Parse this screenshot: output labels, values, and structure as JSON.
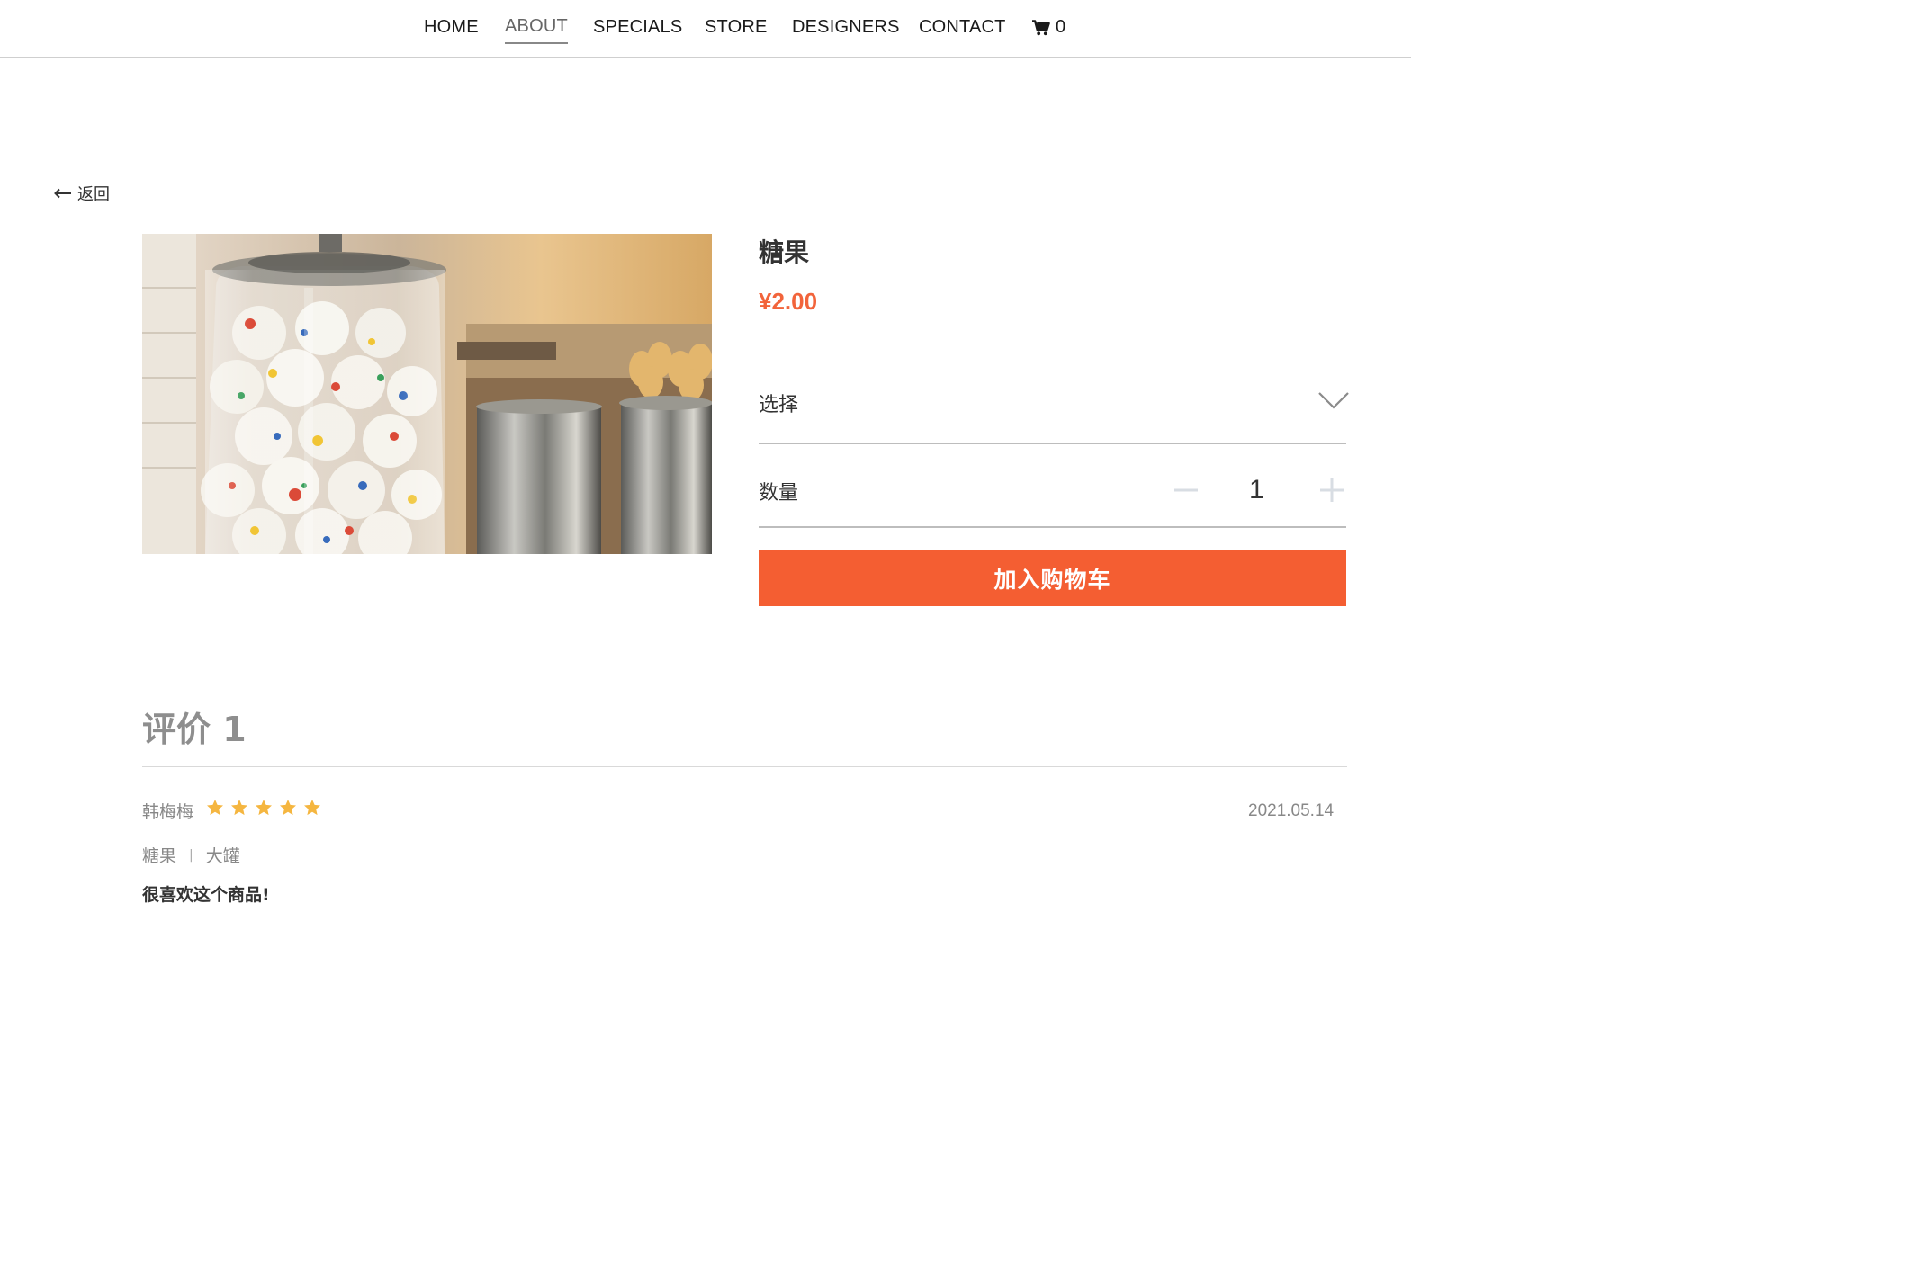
{
  "nav": {
    "items": [
      {
        "label": "HOME"
      },
      {
        "label": "ABOUT"
      },
      {
        "label": "SPECIALS"
      },
      {
        "label": "STORE"
      },
      {
        "label": "DESIGNERS"
      },
      {
        "label": "CONTACT"
      }
    ],
    "active": "ABOUT",
    "cart_count": "0",
    "cart_icon": "shopping-cart-icon"
  },
  "back": {
    "label": "返回",
    "icon": "arrow-left-icon"
  },
  "product": {
    "image_icon": "candy-jar-photo",
    "name": "糖果",
    "price": "¥2.00",
    "option": {
      "label": "选择",
      "icon": "chevron-down-icon"
    },
    "quantity": {
      "label": "数量",
      "value": "1",
      "minus_icon": "minus-icon",
      "plus_icon": "plus-icon"
    },
    "add_to_cart": "加入购物车"
  },
  "reviews": {
    "title": "评价 1",
    "items": [
      {
        "user": "韩梅梅",
        "rating": 5,
        "max_rating": 5,
        "date": "2021.05.14",
        "product": "糖果",
        "separator": "|",
        "variant": "大罐",
        "text": "很喜欢这个商品!"
      }
    ]
  },
  "colors": {
    "accent": "#f45e32",
    "price": "#f2643b",
    "star": "#f5b640"
  }
}
